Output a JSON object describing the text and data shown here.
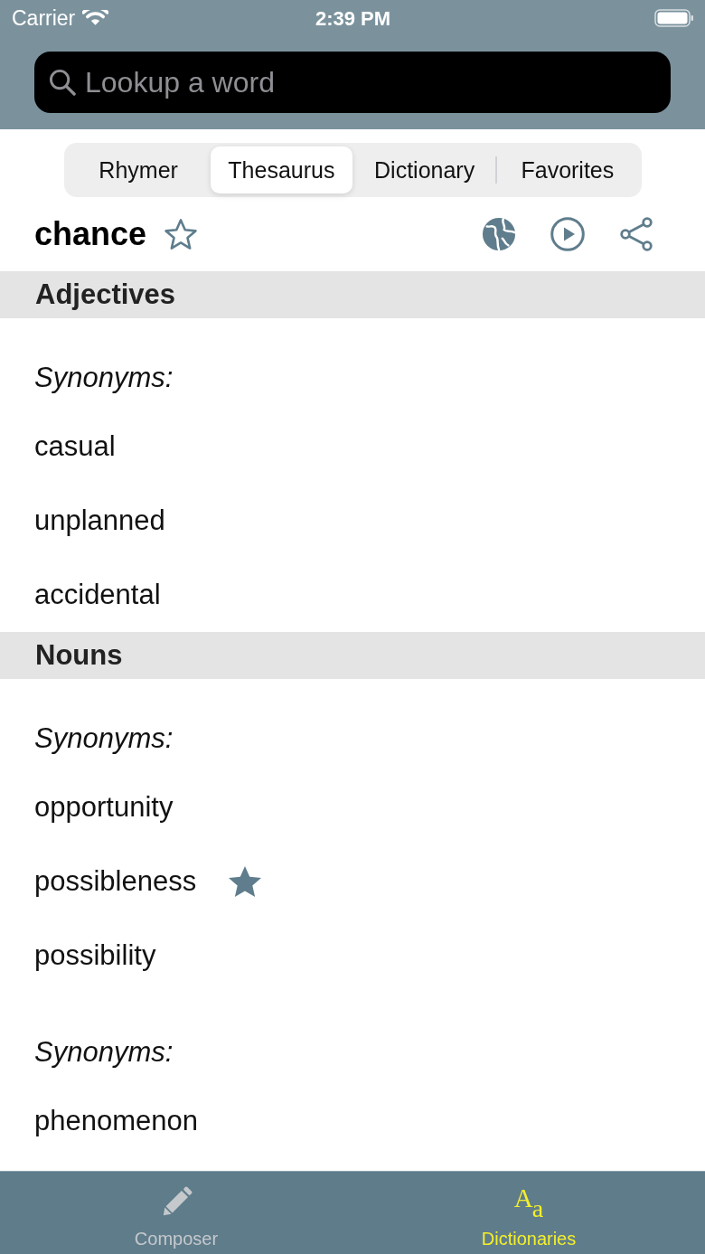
{
  "status_bar": {
    "carrier": "Carrier",
    "time": "2:39 PM"
  },
  "search": {
    "placeholder": "Lookup a word"
  },
  "tabs": [
    {
      "label": "Rhymer",
      "selected": false
    },
    {
      "label": "Thesaurus",
      "selected": true
    },
    {
      "label": "Dictionary",
      "selected": false
    },
    {
      "label": "Favorites",
      "selected": false
    }
  ],
  "entry": {
    "word": "chance",
    "favorite": false
  },
  "sections": [
    {
      "title": "Adjectives",
      "groups": [
        {
          "label": "Synonyms:",
          "words": [
            {
              "text": "casual",
              "favorite": false
            },
            {
              "text": "unplanned",
              "favorite": false
            },
            {
              "text": "accidental",
              "favorite": false
            }
          ]
        }
      ]
    },
    {
      "title": "Nouns",
      "groups": [
        {
          "label": "Synonyms:",
          "words": [
            {
              "text": "opportunity",
              "favorite": false
            },
            {
              "text": "possibleness",
              "favorite": true
            },
            {
              "text": "possibility",
              "favorite": false
            }
          ]
        },
        {
          "label": "Synonyms:",
          "words": [
            {
              "text": "phenomenon",
              "favorite": false
            }
          ]
        }
      ]
    }
  ],
  "tab_bar": {
    "items": [
      {
        "label": "Composer",
        "kind": "pencil",
        "selected": false
      },
      {
        "label": "Dictionaries",
        "kind": "letters",
        "icon_glyphs": [
          "A",
          "a"
        ],
        "selected": true
      }
    ]
  }
}
